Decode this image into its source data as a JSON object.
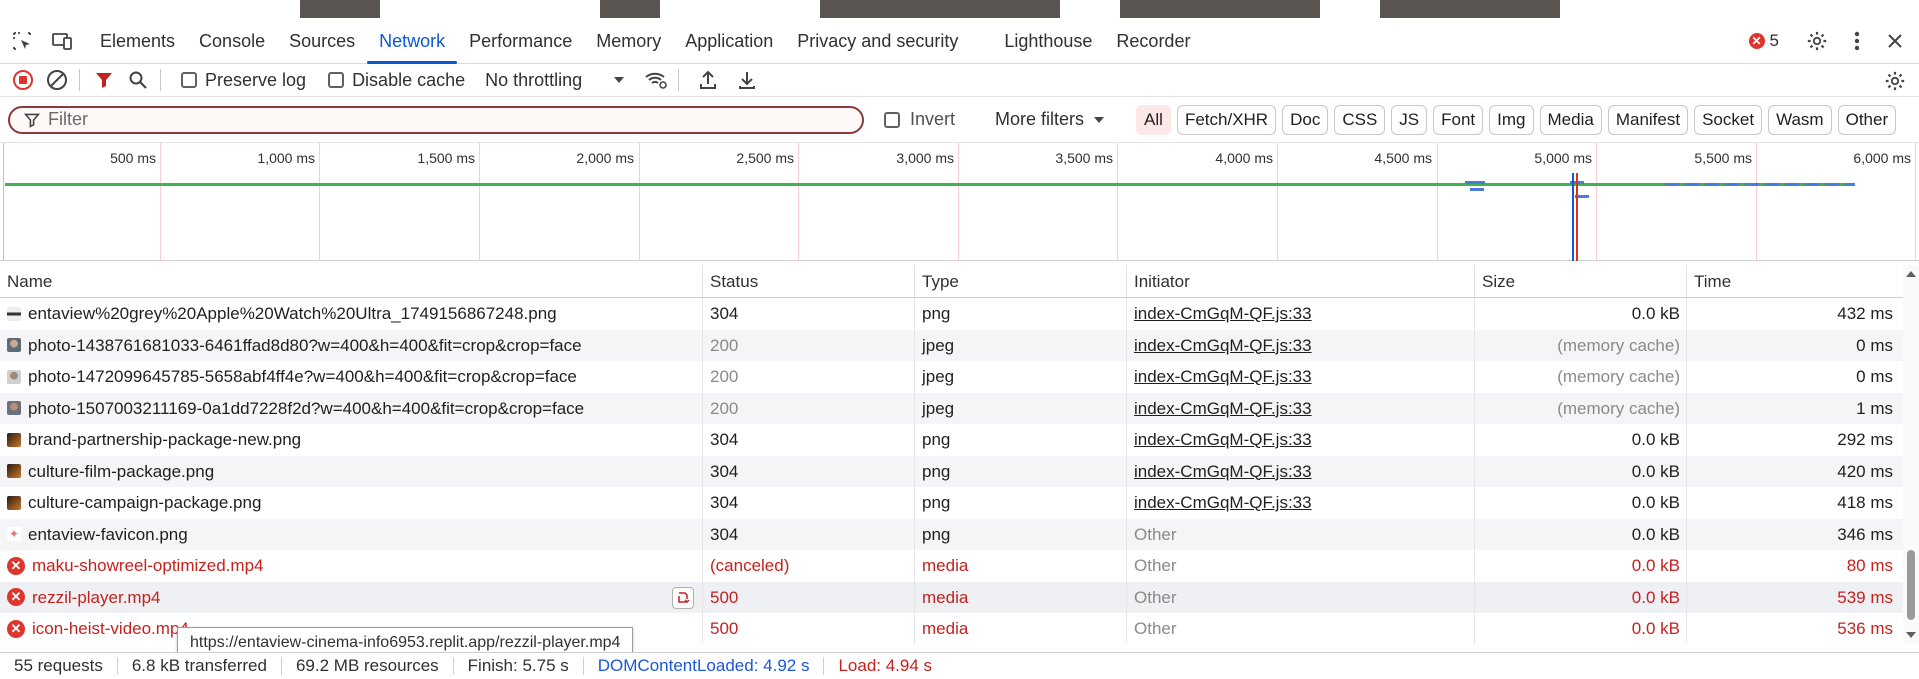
{
  "tabbar": {
    "tabs": [
      "Elements",
      "Console",
      "Sources",
      "Network",
      "Performance",
      "Memory",
      "Application",
      "Privacy and security",
      "Lighthouse",
      "Recorder"
    ],
    "active": "Network",
    "error_count": "5"
  },
  "toolbar": {
    "preserve_log": "Preserve log",
    "disable_cache": "Disable cache",
    "throttling": "No throttling"
  },
  "filter": {
    "placeholder": "Filter",
    "invert": "Invert",
    "more_filters": "More filters",
    "chips": [
      "All",
      "Fetch/XHR",
      "Doc",
      "CSS",
      "JS",
      "Font",
      "Img",
      "Media",
      "Manifest",
      "Socket",
      "Wasm",
      "Other"
    ]
  },
  "timeline": {
    "ticks": [
      "500 ms",
      "1,000 ms",
      "1,500 ms",
      "2,000 ms",
      "2,500 ms",
      "3,000 ms",
      "3,500 ms",
      "4,000 ms",
      "4,500 ms",
      "5,000 ms",
      "5,500 ms",
      "6,000 ms"
    ]
  },
  "table": {
    "headers": [
      "Name",
      "Status",
      "Type",
      "Initiator",
      "Size",
      "Time"
    ],
    "rows": [
      {
        "name": "entaview%20grey%20Apple%20Watch%20Ultra_1749156867248.png",
        "status": "304",
        "type": "png",
        "initiator": "index-CmGqM-QF.js:33",
        "size": "0.0 kB",
        "time": "432 ms",
        "icon": "image-icon",
        "kind": "normal"
      },
      {
        "name": "photo-1438761681033-6461ffad8d80?w=400&h=400&fit=crop&crop=face",
        "status": "200",
        "type": "jpeg",
        "initiator": "index-CmGqM-QF.js:33",
        "size": "(memory cache)",
        "time": "0 ms",
        "icon": "image-icon",
        "kind": "cache"
      },
      {
        "name": "photo-1472099645785-5658abf4ff4e?w=400&h=400&fit=crop&crop=face",
        "status": "200",
        "type": "jpeg",
        "initiator": "index-CmGqM-QF.js:33",
        "size": "(memory cache)",
        "time": "0 ms",
        "icon": "image-icon",
        "kind": "cache"
      },
      {
        "name": "photo-1507003211169-0a1dd7228f2d?w=400&h=400&fit=crop&crop=face",
        "status": "200",
        "type": "jpeg",
        "initiator": "index-CmGqM-QF.js:33",
        "size": "(memory cache)",
        "time": "1 ms",
        "icon": "image-icon",
        "kind": "cache"
      },
      {
        "name": "brand-partnership-package-new.png",
        "status": "304",
        "type": "png",
        "initiator": "index-CmGqM-QF.js:33",
        "size": "0.0 kB",
        "time": "292 ms",
        "icon": "image-icon",
        "kind": "normal"
      },
      {
        "name": "culture-film-package.png",
        "status": "304",
        "type": "png",
        "initiator": "index-CmGqM-QF.js:33",
        "size": "0.0 kB",
        "time": "420 ms",
        "icon": "image-icon",
        "kind": "normal"
      },
      {
        "name": "culture-campaign-package.png",
        "status": "304",
        "type": "png",
        "initiator": "index-CmGqM-QF.js:33",
        "size": "0.0 kB",
        "time": "418 ms",
        "icon": "image-icon",
        "kind": "normal"
      },
      {
        "name": "entaview-favicon.png",
        "status": "304",
        "type": "png",
        "initiator": "Other",
        "size": "0.0 kB",
        "time": "346 ms",
        "icon": "favicon-icon",
        "kind": "other"
      },
      {
        "name": "maku-showreel-optimized.mp4",
        "status": "(canceled)",
        "type": "media",
        "initiator": "Other",
        "size": "0.0 kB",
        "time": "80 ms",
        "icon": "error-icon",
        "kind": "error"
      },
      {
        "name": "rezzil-player.mp4",
        "status": "500",
        "type": "media",
        "initiator": "Other",
        "size": "0.0 kB",
        "time": "539 ms",
        "icon": "error-icon",
        "kind": "error"
      },
      {
        "name": "icon-heist-video.mp4",
        "status": "500",
        "type": "media",
        "initiator": "Other",
        "size": "0.0 kB",
        "time": "536 ms",
        "icon": "error-icon",
        "kind": "error"
      }
    ]
  },
  "tooltip": "https://entaview-cinema-info6953.replit.app/rezzil-player.mp4",
  "statusbar": {
    "requests": "55 requests",
    "transferred": "6.8 kB transferred",
    "resources": "69.2 MB resources",
    "finish": "Finish: 5.75 s",
    "dcl": "DOMContentLoaded: 4.92 s",
    "load": "Load: 4.94 s"
  },
  "colors": {
    "accent": "#0b57d0",
    "error": "#c5221f",
    "timeline_green": "#3fb34f"
  }
}
